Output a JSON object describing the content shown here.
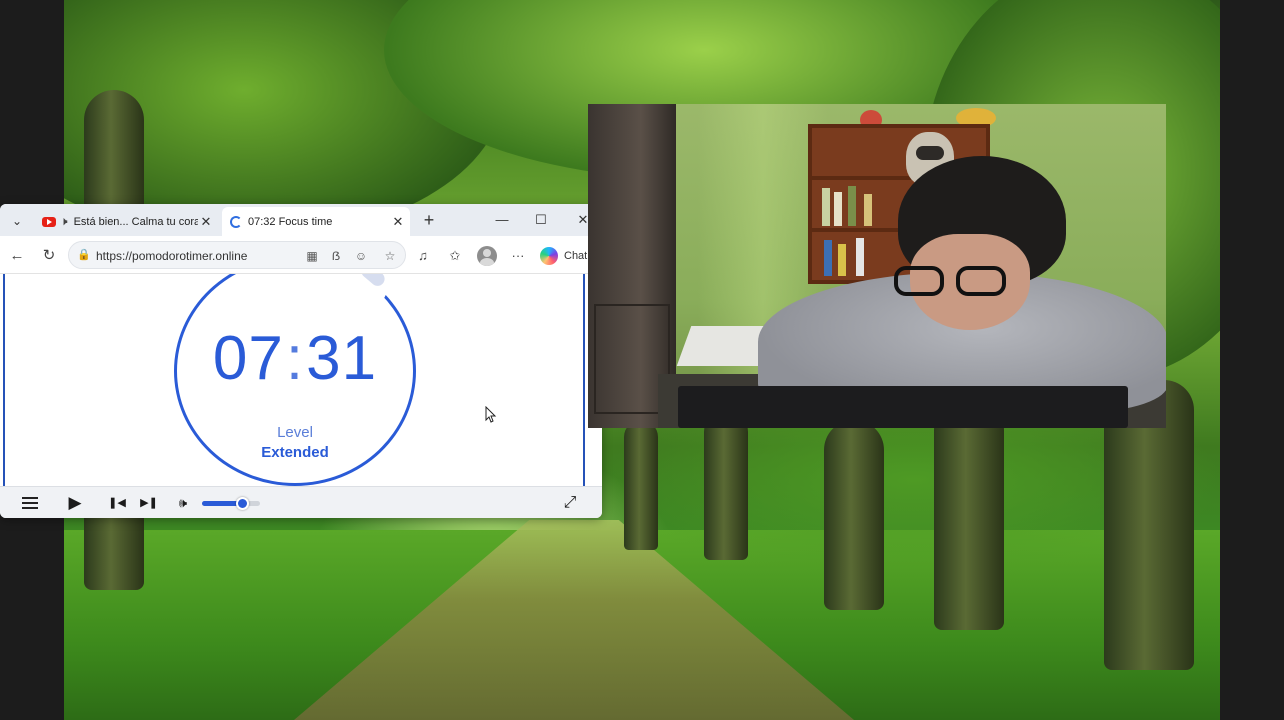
{
  "browser": {
    "tabs": [
      {
        "title": "Está bien... Calma tu cora",
        "audible": true,
        "active": false
      },
      {
        "title": "07:32 Focus time",
        "audible": false,
        "active": true
      }
    ],
    "url": "https://pomodorotimer.online",
    "copilot_label": "Chat"
  },
  "timer": {
    "minutes": "07",
    "separator": ":",
    "seconds": "31",
    "level_label": "Level",
    "level_value": "Extended",
    "accent_color": "#2a5bd7"
  },
  "player": {
    "volume_fraction": 0.7
  },
  "icons": [
    "tab-switcher-icon",
    "youtube-icon",
    "speaker-icon",
    "close-icon",
    "loading-spinner-icon",
    "plus-icon",
    "minimize-icon",
    "maximize-icon",
    "back-icon",
    "reload-icon",
    "lock-icon",
    "grid-icon",
    "translate-icon",
    "emoji-icon",
    "star-icon",
    "media-control-icon",
    "favorites-icon",
    "profile-icon",
    "more-icon",
    "copilot-icon",
    "menu-icon",
    "play-icon",
    "previous-icon",
    "next-icon",
    "volume-icon",
    "fullscreen-icon"
  ]
}
